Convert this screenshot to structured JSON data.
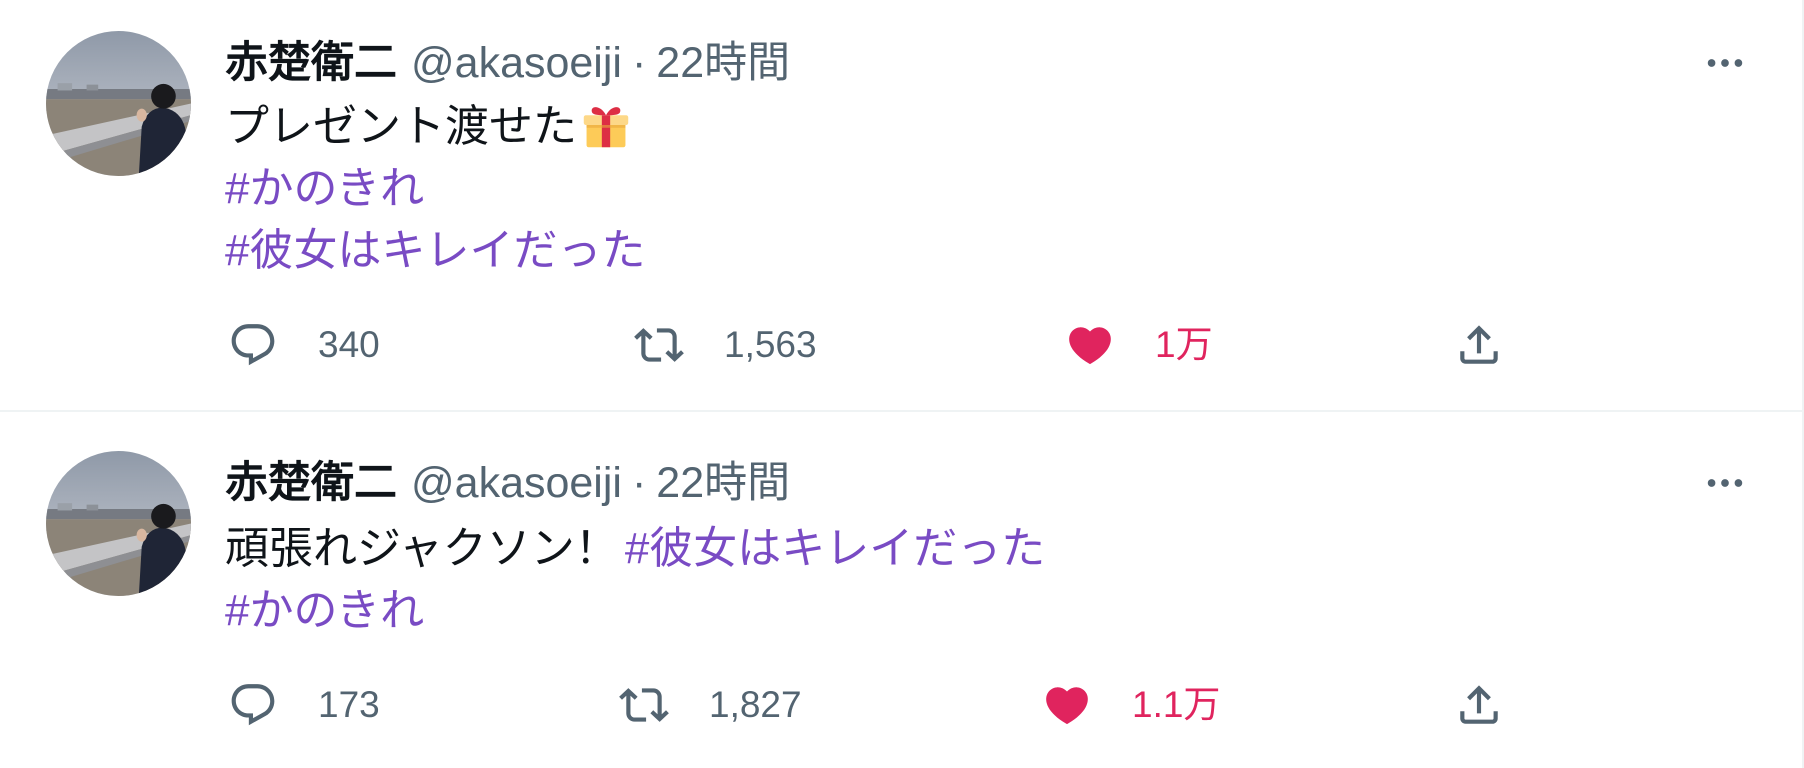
{
  "colors": {
    "text_primary": "#0f1419",
    "text_secondary": "#536471",
    "hashtag": "#794bc4",
    "like": "#e0245e",
    "divider": "#eff3f4"
  },
  "tweets": [
    {
      "author": {
        "name": "赤楚衛二",
        "handle": "@akasoeiji"
      },
      "separator": "·",
      "time": "22時間",
      "more_icon": "more-icon",
      "body": {
        "text": "プレゼント渡せた",
        "emoji": "gift-icon",
        "hashtags": [
          "#かのきれ",
          "#彼女はキレイだった"
        ]
      },
      "actions": {
        "reply": {
          "icon": "reply-icon",
          "count": "340"
        },
        "retweet": {
          "icon": "retweet-icon",
          "count": "1,563"
        },
        "like": {
          "icon": "heart-icon",
          "count": "1万",
          "liked": true
        },
        "share": {
          "icon": "share-icon"
        }
      }
    },
    {
      "author": {
        "name": "赤楚衛二",
        "handle": "@akasoeiji"
      },
      "separator": "·",
      "time": "22時間",
      "more_icon": "more-icon",
      "body": {
        "text": "頑張れジャクソン！",
        "hashtags": [
          "#彼女はキレイだった",
          "#かのきれ"
        ]
      },
      "actions": {
        "reply": {
          "icon": "reply-icon",
          "count": "173"
        },
        "retweet": {
          "icon": "retweet-icon",
          "count": "1,827"
        },
        "like": {
          "icon": "heart-icon",
          "count": "1.1万",
          "liked": true
        },
        "share": {
          "icon": "share-icon"
        }
      }
    }
  ]
}
